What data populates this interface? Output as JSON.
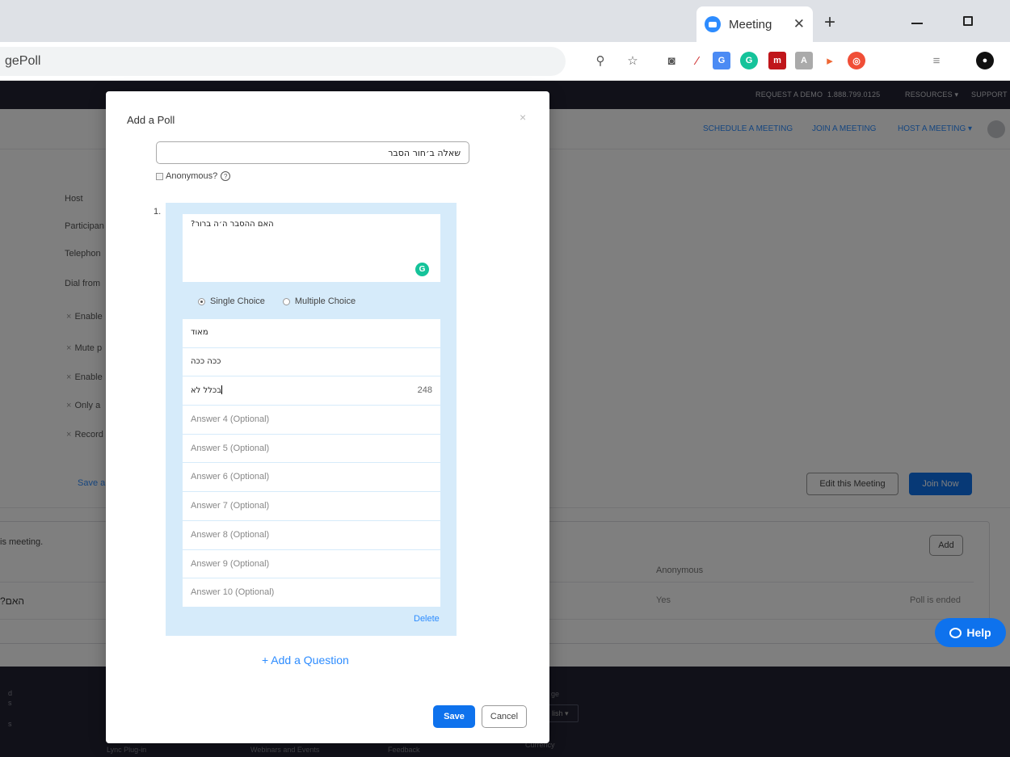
{
  "browser": {
    "tab_title": "Meeting",
    "tab_close": "✕",
    "new_tab": "+",
    "url_text": "gePoll",
    "icons": [
      "zoom-icon",
      "star-icon",
      "camera-icon",
      "eyedropper-icon",
      "translate-icon",
      "grammarly-icon",
      "mendeley-icon",
      "pdf-icon",
      "share-icon",
      "extension-icon",
      "media-icon",
      "profile-icon"
    ]
  },
  "page": {
    "topnav": {
      "request_demo": "REQUEST A DEMO",
      "phone": "1.888.799.0125",
      "resources": "RESOURCES ▾",
      "support": "SUPPORT"
    },
    "subnav": {
      "schedule": "SCHEDULE A MEETING",
      "join": "JOIN A MEETING",
      "host": "HOST A MEETING ▾"
    },
    "side_labels": [
      "Host",
      "Participan",
      "Telephon",
      "Dial from"
    ],
    "side_options": [
      "Enable",
      "Mute p",
      "Enable",
      "Only a",
      "Record"
    ],
    "save_link": "Save a",
    "edit_button": "Edit this Meeting",
    "join_button": "Join Now",
    "poll_section": {
      "description": "is meeting.",
      "add_button": "Add",
      "column_anonymous": "Anonymous",
      "row_question": "?האם",
      "row_anonymous": "Yes",
      "row_status": "Poll is ended"
    },
    "footer": {
      "col1_a": "d",
      "col1_b": "s",
      "col1_c": "s",
      "lync": "Lync Plug-in",
      "webinars": "Webinars and Events",
      "feedback": "Feedback",
      "language_label": "ge",
      "language_value": "lish ▾",
      "currency": "Currency"
    },
    "help_button": "Help"
  },
  "modal": {
    "title": "Add a Poll",
    "close": "×",
    "poll_title_value": "שאלה ב׳חור הסבר",
    "anonymous_label": "Anonymous?",
    "question_number": "1.",
    "question_text": "?האם ההסבר ה׳ה ברור",
    "single_choice_label": "Single Choice",
    "multiple_choice_label": "Multiple Choice",
    "selected_choice": "Single Choice",
    "answers": [
      {
        "value": "מאוד",
        "placeholder": "",
        "count": ""
      },
      {
        "value": "ככה ככה",
        "placeholder": "",
        "count": ""
      },
      {
        "value": "בכלל לא",
        "placeholder": "",
        "count": "248"
      },
      {
        "value": "",
        "placeholder": "Answer 4 (Optional)",
        "count": ""
      },
      {
        "value": "",
        "placeholder": "Answer 5 (Optional)",
        "count": ""
      },
      {
        "value": "",
        "placeholder": "Answer 6 (Optional)",
        "count": ""
      },
      {
        "value": "",
        "placeholder": "Answer 7 (Optional)",
        "count": ""
      },
      {
        "value": "",
        "placeholder": "Answer 8 (Optional)",
        "count": ""
      },
      {
        "value": "",
        "placeholder": "Answer 9 (Optional)",
        "count": ""
      },
      {
        "value": "",
        "placeholder": "Answer 10 (Optional)",
        "count": ""
      }
    ],
    "delete_link": "Delete",
    "add_question": "+ Add a Question",
    "save_button": "Save",
    "cancel_button": "Cancel"
  }
}
